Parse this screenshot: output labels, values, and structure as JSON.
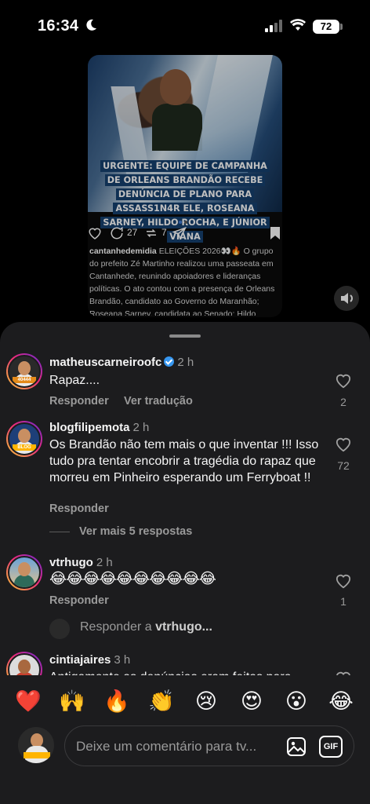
{
  "status": {
    "time": "16:34",
    "battery": "72"
  },
  "post": {
    "headline": "URGENTE: EQUIPE DE CAMPANHA DE ORLEANS BRANDÃO RECEBE DENÚNCIA DE PLANO PARA ASSASS1N4R ELE, ROSEANA SARNEY, HILDO ROCHA, E JÚNIOR VIANA",
    "comments_count": "27",
    "reposts_count": "7",
    "caption_user": "cantanhedemidia",
    "caption_text": "ELEIÇÕES 2026👀🔥 O grupo do prefeito Zé Martinho realizou uma passeata em Cantanhede, reunindo apoiadores e lideranças políticas. O ato contou com a presença de Orleans Brandão, candidato ao Governo do Maranhão; Roseana Sarney, candidata ao Senado; Hildo Rocha"
  },
  "comments": [
    {
      "user": "matheuscarneiroofc",
      "time": "2 h",
      "verified": true,
      "text": "Rapaz....",
      "reply": "Responder",
      "translate": "Ver tradução",
      "likes": "2",
      "avatar_tag": "40444"
    },
    {
      "user": "blogfilipemota",
      "time": "2 h",
      "text": "Os Brandão não tem mais o que inventar !!! Isso tudo pra tentar encobrir a tragédia do rapaz que morreu em Pinheiro esperando um Ferryboat !!",
      "reply": "Responder",
      "likes": "72",
      "more_replies": "Ver mais 5 respostas"
    },
    {
      "user": "vtrhugo",
      "time": "2 h",
      "text": "😂😂😂😂😂😂😂😂😂😂",
      "reply": "Responder",
      "likes": "1"
    },
    {
      "user": "cintiajaires",
      "time": "3 h",
      "text": "Antigamente as denúncias eram feitas para"
    }
  ],
  "reply_to": {
    "prefix": "Responder a ",
    "user": "vtrhugo..."
  },
  "quick_reactions": [
    "❤️",
    "🙌",
    "🔥",
    "👏",
    "😢",
    "😍",
    "😮",
    "😂"
  ],
  "composer": {
    "placeholder": "Deixe um comentário para tv...",
    "gif_label": "GIF"
  },
  "colors": {
    "sheet": "#1c1c1e",
    "verified": "#3797f0",
    "secondary_text": "#9a9a9a"
  }
}
